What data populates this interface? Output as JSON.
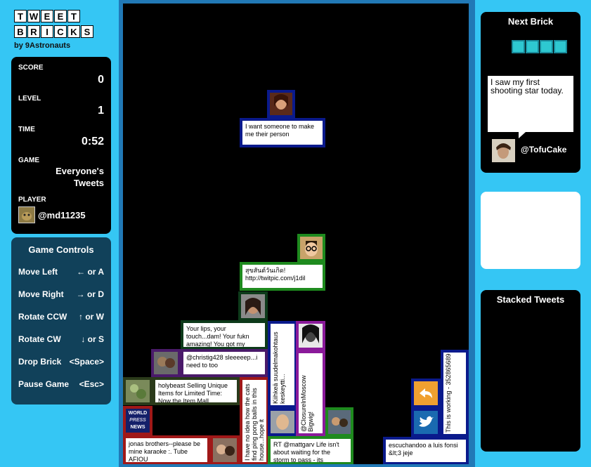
{
  "logo": {
    "row1": [
      "T",
      "W",
      "E",
      "E",
      "T"
    ],
    "row2": [
      "B",
      "R",
      "I",
      "C",
      "K",
      "S"
    ],
    "byline": "by 9Astronauts"
  },
  "stats": {
    "score_label": "SCORE",
    "score_value": "0",
    "level_label": "LEVEL",
    "level_value": "1",
    "time_label": "TIME",
    "time_value": "0:52",
    "game_label": "GAME",
    "game_value_line1": "Everyone's",
    "game_value_line2": "Tweets",
    "player_label": "PLAYER",
    "player_value": "@md11235"
  },
  "controls": {
    "title": "Game Controls",
    "rows": [
      {
        "label": "Move Left",
        "key": "← or A"
      },
      {
        "label": "Move Right",
        "key": "→ or D"
      },
      {
        "label": "Rotate CCW",
        "key": "↑ or W"
      },
      {
        "label": "Rotate CW",
        "key": "↓ or S"
      },
      {
        "label": "Drop Brick",
        "key": "<Space>"
      },
      {
        "label": "Pause Game",
        "key": "<Esc>"
      }
    ]
  },
  "next_brick": {
    "title": "Next Brick",
    "tweet": "I saw my first shooting star today.",
    "user": "@TofuCake",
    "brick_color": "#2ec8d0"
  },
  "stacked": {
    "title": "Stacked Tweets"
  },
  "board": {
    "falling": {
      "text": "I want someone to make me their person",
      "color": "#0a1a8c"
    },
    "tweets": {
      "green_top": "สุขสันต์วันเกิด! http://twitpic.com/j1dil",
      "dark_green": "Your lips, your touch...dam! Your fukn amazing! You got my",
      "purple_gray": "@christig428 sleeeeep...i need to too",
      "olive": "holybeast Selling Unique Items for Limited Time: Now the Item Mall...",
      "red": "jonas brothers--please be mine karaoke :. Tube AFIOU",
      "vertical_white": "I have no idea how the cats find ping pong balls in this house...hope it",
      "vertical_blue": "Kiihkeä suudelmakohtaus keskeytti...",
      "vertical_purple": "@ClosureInMoscow Bigwig!",
      "rt_green": "RT @mattgarv Life isn't about waiting for the storm to pass - its",
      "blue_right": "escuchandoo a luis fonsi &lt;3 jeje",
      "vertical_right": "This is working - 352865689",
      "world_news": [
        "WORLD",
        "PRESS",
        "NEWS"
      ]
    },
    "colors": {
      "green": "#1e8a1e",
      "dark_green": "#0d3a1a",
      "purple": "#4a1a6a",
      "red": "#a01818",
      "navy": "#0a1a8c",
      "magenta": "#8a1a9a",
      "olive": "#2a3a1a"
    }
  }
}
